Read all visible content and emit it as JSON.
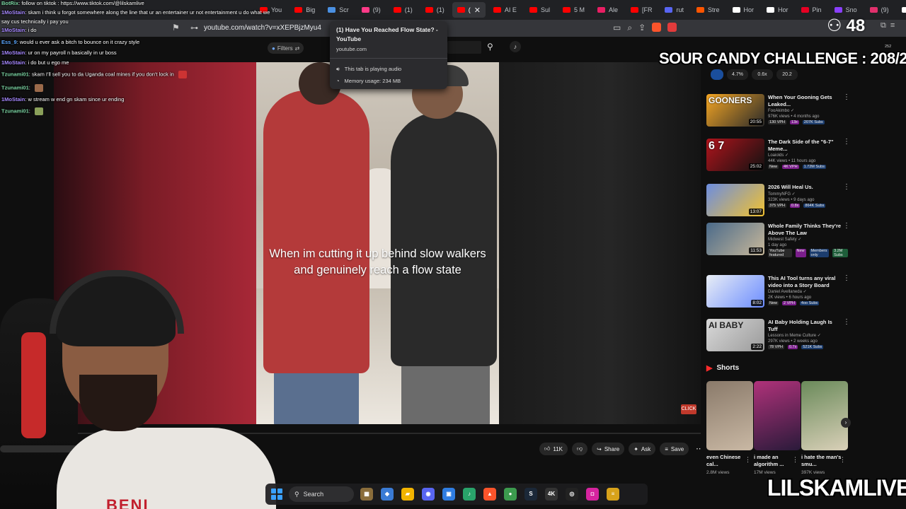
{
  "browser": {
    "tabs": [
      {
        "label": "You",
        "color": "#ff0000"
      },
      {
        "label": "Big",
        "color": "#ff0000"
      },
      {
        "label": "Scr",
        "color": "#4a90e2"
      },
      {
        "label": "(9)",
        "color": "#ff3a88"
      },
      {
        "label": "(1)",
        "color": "#ff0000"
      },
      {
        "label": "(1)",
        "color": "#ff0000"
      },
      {
        "label": "(",
        "color": "#ff0000",
        "active": true
      },
      {
        "label": "AI E",
        "color": "#ff0000"
      },
      {
        "label": "Sul",
        "color": "#ff0000"
      },
      {
        "label": "5 M",
        "color": "#ff0000"
      },
      {
        "label": "Ale",
        "color": "#e91e63"
      },
      {
        "label": "[FR",
        "color": "#ff0000"
      },
      {
        "label": "rut",
        "color": "#5865f2"
      },
      {
        "label": "Stre",
        "color": "#ff5500"
      },
      {
        "label": "Hor",
        "color": "#ffffff"
      },
      {
        "label": "Hor",
        "color": "#ffffff"
      },
      {
        "label": "Pin",
        "color": "#e60023"
      },
      {
        "label": "Sno",
        "color": "#8a3ffc"
      },
      {
        "label": "(9)",
        "color": "#e1306c"
      },
      {
        "label": "lils",
        "color": "#ffffff"
      },
      {
        "label": "Sett",
        "color": "#bbbbbb"
      }
    ],
    "url": "youtube.com/watch?v=xXEPBjzMyu4",
    "hover_card": {
      "title": "(1) Have You Reached Flow State? - YouTube",
      "domain": "youtube.com",
      "audio_status": "This tab is playing audio",
      "memory": "Memory usage: 234 MB"
    }
  },
  "youtube": {
    "filters_label": "Filters",
    "caption": "When im cutting it up behind slow walkers and genuinely reach a flow state",
    "click_badge": "CLICK",
    "actions": {
      "likes": "11K",
      "share": "Share",
      "ask": "Ask",
      "save": "Save"
    },
    "stat_chips": [
      "",
      "4.7%",
      "0.6x",
      "20.2"
    ],
    "recommendations": [
      {
        "title": "When Your Gooning Gets Leaked...",
        "channel": "FooAkimbo",
        "meta": "976K views • 4 months ago",
        "duration": "20:55",
        "tags": [
          "130 VPH",
          "13x",
          "207K Subs"
        ],
        "colors": [
          "#f5a623",
          "#2a2a2a"
        ],
        "thumb_text": "GOONERS"
      },
      {
        "title": "The Dark Side of the \"6-7\" Meme...",
        "channel": "Loaiolds",
        "meta": "44K views • 11 hours ago",
        "duration": "25:02",
        "tags": [
          "New",
          "4K VPH",
          "1.72M Subs"
        ],
        "colors": [
          "#b0141c",
          "#111111"
        ],
        "thumb_text": "6 7"
      },
      {
        "title": "2026 Will Heal Us.",
        "channel": "TommyNFG",
        "meta": "323K views • 9 days ago",
        "duration": "13:07",
        "tags": [
          "375 VPH",
          "0.8x",
          "864K Subs"
        ],
        "colors": [
          "#6c8de0",
          "#f2c230"
        ],
        "thumb_text": ""
      },
      {
        "title": "Whole Family Thinks They're Above The Law",
        "channel": "Midwest Safety",
        "meta": "1 day ago",
        "duration": "11:53",
        "tags": [
          "YouTube featured",
          "New",
          "Members only",
          "3.2M Subs"
        ],
        "colors": [
          "#4a6a8a",
          "#c8b89a"
        ],
        "thumb_text": ""
      },
      {
        "title": "This AI Tool turns any viral video into a Story Board",
        "channel": "Daniel Avellaneda",
        "meta": "2K views • 6 hours ago",
        "duration": "8:02",
        "tags": [
          "New",
          "2 VPH",
          "4oo Subs"
        ],
        "colors": [
          "#e9eef5",
          "#6b8cff"
        ],
        "thumb_text": ""
      },
      {
        "title": "AI Baby Holding Laugh Is Tuff",
        "channel": "Lessons in Meme Culture",
        "meta": "297K views • 2 weeks ago",
        "duration": "2:22",
        "tags": [
          "78 VPH",
          "0.7x",
          "521K Subs"
        ],
        "colors": [
          "#d9d9d9",
          "#9a9a9a"
        ],
        "thumb_text": "AI BABY"
      }
    ],
    "shorts": {
      "header": "Shorts",
      "items": [
        {
          "title": "even Chinese cal...",
          "views": "2.8M views",
          "colors": [
            "#8a7a6a",
            "#c9b8a4"
          ]
        },
        {
          "title": "i made an algorithm ...",
          "views": "17M views",
          "colors": [
            "#b0327a",
            "#2a1a3a"
          ]
        },
        {
          "title": "i hate the man's smu...",
          "views": "397K views",
          "colors": [
            "#6a8a5a",
            "#d9d0b8"
          ]
        }
      ]
    }
  },
  "stream": {
    "chat": [
      {
        "user": "BotRix",
        "text": ": follow on tiktok : https://www.tiktok.com/@lilskamlive",
        "color": "green"
      },
      {
        "user": "1MoStain",
        "text": ": skam i think u forgot somewhere along the line that ur an entertainer ur not entertainment u do what we",
        "color": "purple"
      },
      {
        "user": "",
        "text": "say cus technically i pay you",
        "color": "purple"
      },
      {
        "user": "1MoStain",
        "text": ": i do",
        "color": "purple"
      },
      {
        "user": "Ess_9",
        "text": ": would u ever ask a bitch to bounce on it crazy style",
        "color": "blue"
      },
      {
        "user": "1MoStain",
        "text": ": ur on my payroll n basically in ur boss",
        "color": "purple"
      },
      {
        "user": "1MoStain",
        "text": ": i do but u ego me",
        "color": "purple"
      },
      {
        "user": "Tzunami01",
        "text": ": skam I'll sell you to da Uganda coal mines if you don't lock in",
        "color": "green"
      },
      {
        "user": "Tzunami01",
        "text": ":",
        "color": "green"
      },
      {
        "user": "1MoStain",
        "text": ": w stream w end gn skam since ur ending",
        "color": "purple"
      },
      {
        "user": "Tzunami01",
        "text": ":",
        "color": "green"
      }
    ],
    "viewer_count": "48",
    "challenge": "SOUR CANDY CHALLENGE : 208/250",
    "mini_stats": "252",
    "channel_name": "LILSKAMLIVE",
    "shirt_text": "BENI"
  },
  "taskbar": {
    "search_label": "Search",
    "apps": [
      {
        "name": "widgets",
        "color": "#8a6d3b",
        "glyph": "▦"
      },
      {
        "name": "copilot",
        "color": "#3a7bd5",
        "glyph": "◆"
      },
      {
        "name": "file-explorer",
        "color": "#f2b400",
        "glyph": "▰"
      },
      {
        "name": "discord",
        "color": "#5865f2",
        "glyph": "◉"
      },
      {
        "name": "store",
        "color": "#2f7de1",
        "glyph": "▣"
      },
      {
        "name": "media",
        "color": "#29a36a",
        "glyph": "♪"
      },
      {
        "name": "brave",
        "color": "#fb542b",
        "glyph": "▲"
      },
      {
        "name": "chrome",
        "color": "#3c9b4e",
        "glyph": "●"
      },
      {
        "name": "steam",
        "color": "#1b2838",
        "glyph": "S"
      },
      {
        "name": "4k-app",
        "color": "#333333",
        "glyph": "4K"
      },
      {
        "name": "obs",
        "color": "#222222",
        "glyph": "◎"
      },
      {
        "name": "instagram",
        "color": "#d6249f",
        "glyph": "◘"
      },
      {
        "name": "stacks",
        "color": "#d8a21a",
        "glyph": "≡"
      }
    ]
  }
}
